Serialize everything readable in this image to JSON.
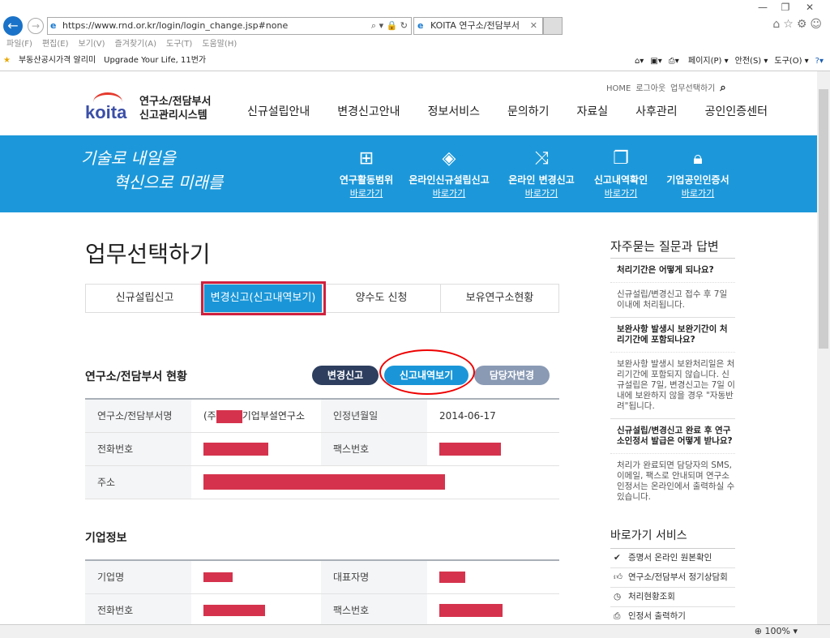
{
  "browser": {
    "url": "https://www.rnd.or.kr/login/login_change.jsp#none",
    "tab_title": "KOITA 연구소/전담부서",
    "menu": [
      "파일(F)",
      "편집(E)",
      "보기(V)",
      "즐겨찾기(A)",
      "도구(T)",
      "도움말(H)"
    ],
    "favorites": [
      "부동산공시가격 알리미",
      "Upgrade Your Life, 11번가"
    ],
    "commands": [
      "페이지(P) ▾",
      "안전(S) ▾",
      "도구(O) ▾"
    ],
    "zoom": "100%"
  },
  "header": {
    "logo": "koita",
    "system_name_1": "연구소/전담부서",
    "system_name_2": "신고관리시스템",
    "util": [
      "HOME",
      "로그아웃",
      "업무선택하기"
    ],
    "nav": [
      "신규설립안내",
      "변경신고안내",
      "정보서비스",
      "문의하기",
      "자료실",
      "사후관리",
      "공인인증센터"
    ]
  },
  "banner": {
    "slogan_1": "기술로 내일을",
    "slogan_2": "혁신으로 미래를",
    "links": [
      {
        "label": "연구활동범위",
        "go": "바로가기",
        "icon": "sitemap-icon"
      },
      {
        "label": "온라인신규설립신고",
        "go": "바로가기",
        "icon": "layers-icon"
      },
      {
        "label": "온라인 변경신고",
        "go": "바로가기",
        "icon": "shuffle-icon"
      },
      {
        "label": "신고내역확인",
        "go": "바로가기",
        "icon": "documents-icon"
      },
      {
        "label": "기업공인인증서",
        "go": "바로가기",
        "icon": "lock-icon"
      }
    ]
  },
  "main": {
    "title": "업무선택하기",
    "tabs": [
      "신규설립신고",
      "변경신고(신고내역보기)",
      "양수도 신청",
      "보유연구소현황"
    ],
    "section1": "연구소/전담부서 현황",
    "buttons": {
      "change": "변경신고",
      "history": "신고내역보기",
      "manager": "담당자변경"
    },
    "lab": {
      "name_label": "연구소/전담부서명",
      "name_prefix": "(주",
      "name_suffix": "기업부설연구소",
      "date_label": "인정년월일",
      "date": "2014-06-17",
      "phone_label": "전화번호",
      "fax_label": "팩스번호",
      "address_label": "주소"
    },
    "section2": "기업정보",
    "company": {
      "name_label": "기업명",
      "ceo_label": "대표자명",
      "phone_label": "전화번호",
      "fax_label": "팩스번호"
    }
  },
  "sidebar": {
    "faq_title": "자주묻는 질문과 답변",
    "faq": [
      {
        "q": "처리기간은 어떻게 되나요?",
        "a": "신규설립/변경신고 접수 후 7일 이내에 처리됩니다."
      },
      {
        "q": "보완사항 발생시 보완기간이 처리기간에 포함되나요?",
        "a": "보완사항 발생시 보완처리일은 처리기간에 포함되지 않습니다. 신규설립은 7일, 변경신고는 7일 이내에 보완하지 않을 경우 \"자동반려\"됩니다."
      },
      {
        "q": "신규설립/변경신고 완료 후 연구소인정서 발급은 어떻게 받나요?",
        "a": "처리가 완료되면 담당자의 SMS, 이메일, 팩스로 안내되며 연구소 인정서는 온라인에서 출력하실 수 있습니다."
      }
    ],
    "quick_title": "바로가기 서비스",
    "quick": [
      "증명서 온라인 원본확인",
      "연구소/전담부서 정기상담회",
      "처리현황조회",
      "인정서 출력하기"
    ]
  },
  "colors": {
    "brand_blue": "#1c98da",
    "dark_button": "#2d3e5e",
    "disabled_button": "#8a9ab4",
    "redaction": "#d5334d",
    "annotation": "#e00000"
  }
}
